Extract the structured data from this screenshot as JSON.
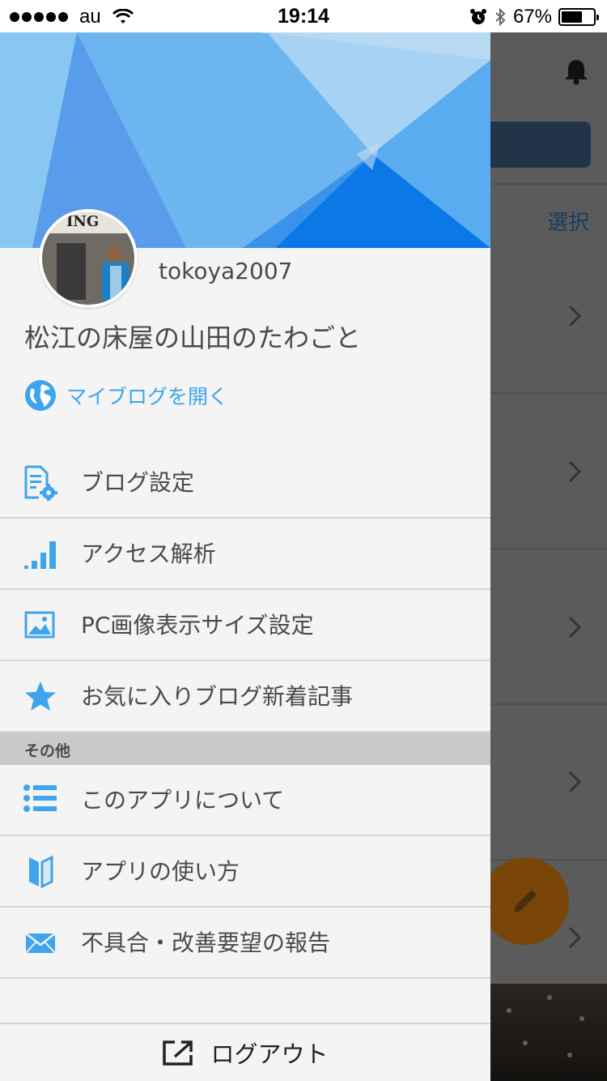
{
  "status_bar": {
    "carrier": "au",
    "time": "19:14",
    "battery": "67%",
    "battery_level": 0.67
  },
  "background": {
    "select_label": "選択"
  },
  "drawer": {
    "profile": {
      "username": "tokoya2007",
      "blog_title": "松江の床屋の山田のたわごと",
      "open_blog_label": "マイブログを開く",
      "avatar_sign": "ING"
    },
    "menu": [
      {
        "label": "ブログ設定",
        "icon": "blog-settings-icon"
      },
      {
        "label": "アクセス解析",
        "icon": "bar-chart-icon"
      },
      {
        "label": "PC画像表示サイズ設定",
        "icon": "image-icon"
      },
      {
        "label": "お気に入りブログ新着記事",
        "icon": "star-icon"
      }
    ],
    "section_other": "その他",
    "other_menu": [
      {
        "label": "このアプリについて",
        "icon": "list-icon"
      },
      {
        "label": "アプリの使い方",
        "icon": "beginner-mark-icon"
      },
      {
        "label": "不具合・改善要望の報告",
        "icon": "mail-icon"
      }
    ],
    "logout_label": "ログアウト"
  },
  "colors": {
    "accent": "#3fa4ec",
    "text": "#4a4a4a",
    "section_bg": "#c9c9c9",
    "fab": "#7a4508"
  }
}
